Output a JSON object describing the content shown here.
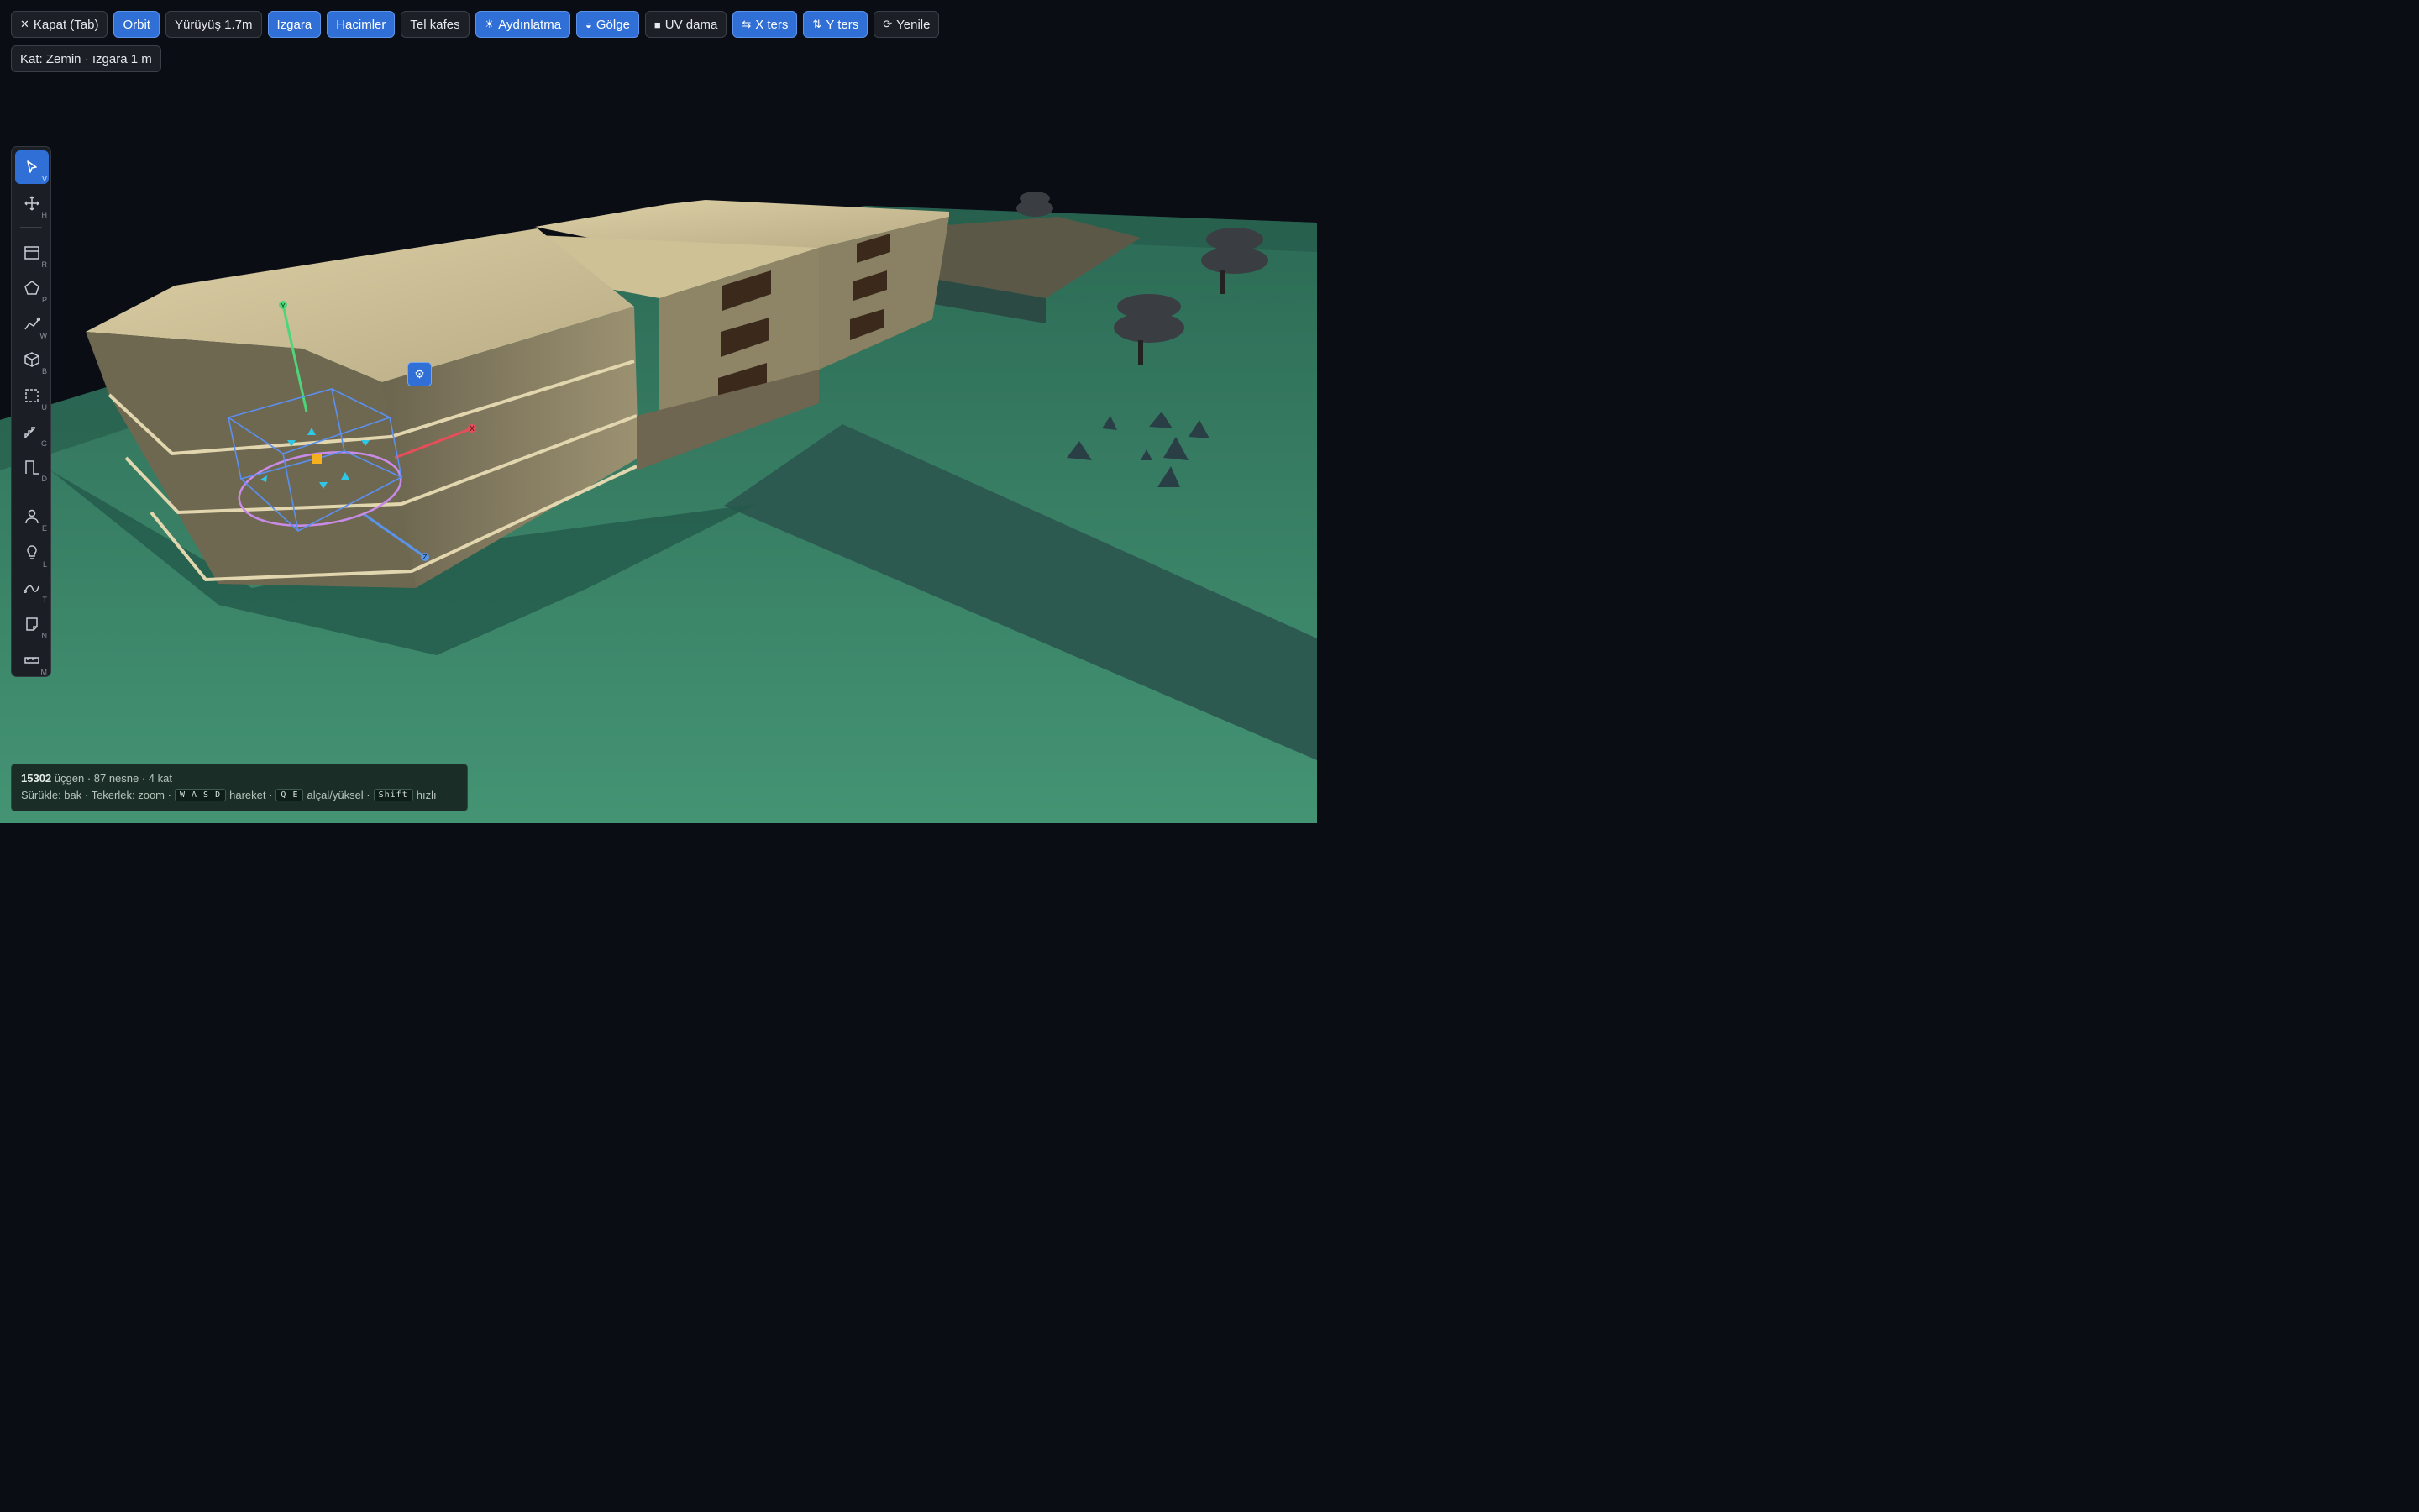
{
  "toolbar": {
    "close": "Kapat (Tab)",
    "orbit": "Orbit",
    "walk": "Yürüyüş 1.7m",
    "grid": "Izgara",
    "volumes": "Hacimler",
    "wireframe": "Tel kafes",
    "lighting": "Aydınlatma",
    "shadow": "Gölge",
    "uv": "UV dama",
    "flip_x": "X ters",
    "flip_y": "Y ters",
    "refresh": "Yenile"
  },
  "toggles": {
    "orbit": true,
    "walk": false,
    "grid": true,
    "volumes": true,
    "wireframe": false,
    "lighting": true,
    "shadow": true,
    "uv": false,
    "flip_x": true,
    "flip_y": true
  },
  "floor_chip": "Kat: Zemin · ızgara 1 m",
  "tools": [
    {
      "name": "select-tool",
      "icon": "cursor-icon",
      "key": "V",
      "active": true
    },
    {
      "name": "pan-tool",
      "icon": "move-icon",
      "key": "H",
      "active": false
    },
    {
      "name": "room-tool",
      "icon": "room-icon",
      "key": "R",
      "active": false
    },
    {
      "name": "polygon-tool",
      "icon": "pentagon-icon",
      "key": "P",
      "active": false
    },
    {
      "name": "wall-tool",
      "icon": "wall-icon",
      "key": "W",
      "active": false
    },
    {
      "name": "box-tool",
      "icon": "cube-icon",
      "key": "B",
      "active": false
    },
    {
      "name": "void-tool",
      "icon": "dashed-square-icon",
      "key": "U",
      "active": false
    },
    {
      "name": "stair-tool",
      "icon": "stairs-icon",
      "key": "G",
      "active": false
    },
    {
      "name": "door-tool",
      "icon": "door-icon",
      "key": "D",
      "active": false
    },
    {
      "name": "person-tool",
      "icon": "person-icon",
      "key": "E",
      "active": false
    },
    {
      "name": "light-tool",
      "icon": "bulb-icon",
      "key": "L",
      "active": false
    },
    {
      "name": "path-tool",
      "icon": "curve-icon",
      "key": "T",
      "active": false
    },
    {
      "name": "note-tool",
      "icon": "note-icon",
      "key": "N",
      "active": false
    },
    {
      "name": "measure-tool",
      "icon": "ruler-icon",
      "key": "M",
      "active": false
    }
  ],
  "status": {
    "triangles": "15302",
    "triangles_suffix": "üçgen · 87 nesne · 4 kat",
    "hint_drag": "Sürükle: bak · Tekerlek: zoom ·",
    "kbd_move": "W A S D",
    "hint_move": "hareket ·",
    "kbd_updown": "Q E",
    "hint_updown": "alçal/yüksel ·",
    "kbd_fast": "Shift",
    "hint_fast": "hızlı"
  },
  "gizmo": {
    "axis_x": "X",
    "axis_y": "Y",
    "axis_z": "Z"
  },
  "colors": {
    "sky": "#0a0d14",
    "ground": "#3f8f70",
    "building_top": "#d6c79c",
    "building_side": "#8c8266",
    "accent": "#2f6fd6",
    "gizmo_ring": "#c98be8",
    "gizmo_box": "#5b8ff0"
  }
}
